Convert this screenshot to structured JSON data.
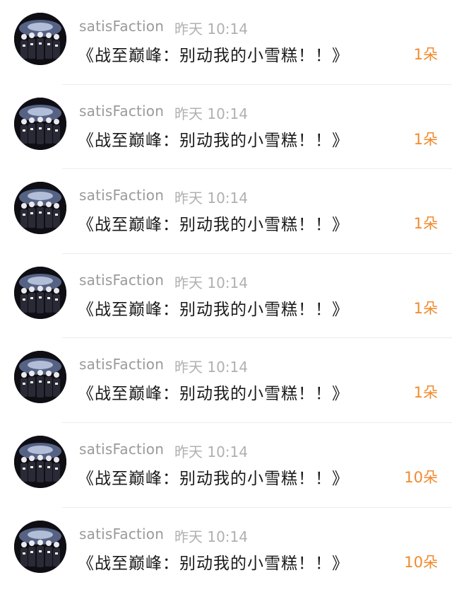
{
  "messages": [
    {
      "sender": "satisFaction",
      "time": "昨天 10:14",
      "text": "《战至巅峰：别动我的小雪糕！！》",
      "count": "1朵"
    },
    {
      "sender": "satisFaction",
      "time": "昨天 10:14",
      "text": "《战至巅峰：别动我的小雪糕！！》",
      "count": "1朵"
    },
    {
      "sender": "satisFaction",
      "time": "昨天 10:14",
      "text": "《战至巅峰：别动我的小雪糕！！》",
      "count": "1朵"
    },
    {
      "sender": "satisFaction",
      "time": "昨天 10:14",
      "text": "《战至巅峰：别动我的小雪糕！！》",
      "count": "1朵"
    },
    {
      "sender": "satisFaction",
      "time": "昨天 10:14",
      "text": "《战至巅峰：别动我的小雪糕！！》",
      "count": "1朵"
    },
    {
      "sender": "satisFaction",
      "time": "昨天 10:14",
      "text": "《战至巅峰：别动我的小雪糕！！》",
      "count": "10朵"
    },
    {
      "sender": "satisFaction",
      "time": "昨天 10:14",
      "text": "《战至巅峰：别动我的小雪糕！！》",
      "count": "10朵"
    }
  ],
  "colors": {
    "count_accent": "#f08a2c",
    "sender": "#9a9a9a",
    "time": "#b0b0b0",
    "text": "#1a1a1a"
  }
}
